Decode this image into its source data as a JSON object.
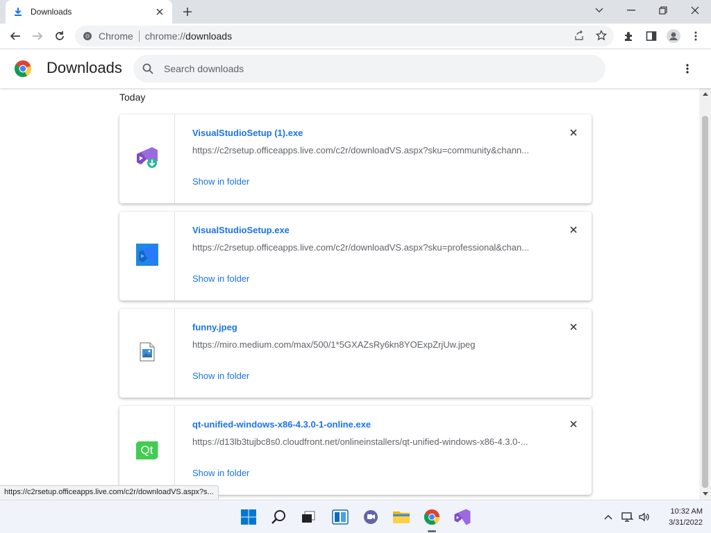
{
  "tab": {
    "title": "Downloads",
    "close_label": "×",
    "newtab_label": "+"
  },
  "window": {
    "controls": [
      "chevron-down",
      "minimize",
      "restore",
      "close"
    ]
  },
  "omnibox": {
    "chip": "Chrome",
    "scheme": "chrome://",
    "host": "downloads"
  },
  "header": {
    "title": "Downloads",
    "search_placeholder": "Search downloads"
  },
  "section": {
    "label": "Today"
  },
  "downloads": [
    {
      "name": "VisualStudioSetup (1).exe",
      "url": "https://c2rsetup.officeapps.live.com/c2r/downloadVS.aspx?sku=community&chann...",
      "action": "Show in folder",
      "icon": "visual-studio-installer-icon"
    },
    {
      "name": "VisualStudioSetup.exe",
      "url": "https://c2rsetup.officeapps.live.com/c2r/downloadVS.aspx?sku=professional&chan...",
      "action": "Show in folder",
      "icon": "visual-studio-blue-icon"
    },
    {
      "name": "funny.jpeg",
      "url": "https://miro.medium.com/max/500/1*5GXAZsRy6kn8YOExpZrjUw.jpeg",
      "action": "Show in folder",
      "icon": "image-file-icon"
    },
    {
      "name": "qt-unified-windows-x86-4.3.0-1-online.exe",
      "url": "https://d13lb3tujbc8s0.cloudfront.net/onlineinstallers/qt-unified-windows-x86-4.3.0-...",
      "action": "Show in folder",
      "icon": "qt-icon",
      "icon_text": "Qt"
    }
  ],
  "status_bar": {
    "text": "https://c2rsetup.officeapps.live.com/c2r/downloadVS.aspx?s..."
  },
  "taskbar": {
    "time": "10:32 AM",
    "date": "3/31/2022"
  },
  "colors": {
    "link": "#1a73e8",
    "tabstrip": "#dee1e6",
    "taskbar": "#f0f3f9"
  }
}
